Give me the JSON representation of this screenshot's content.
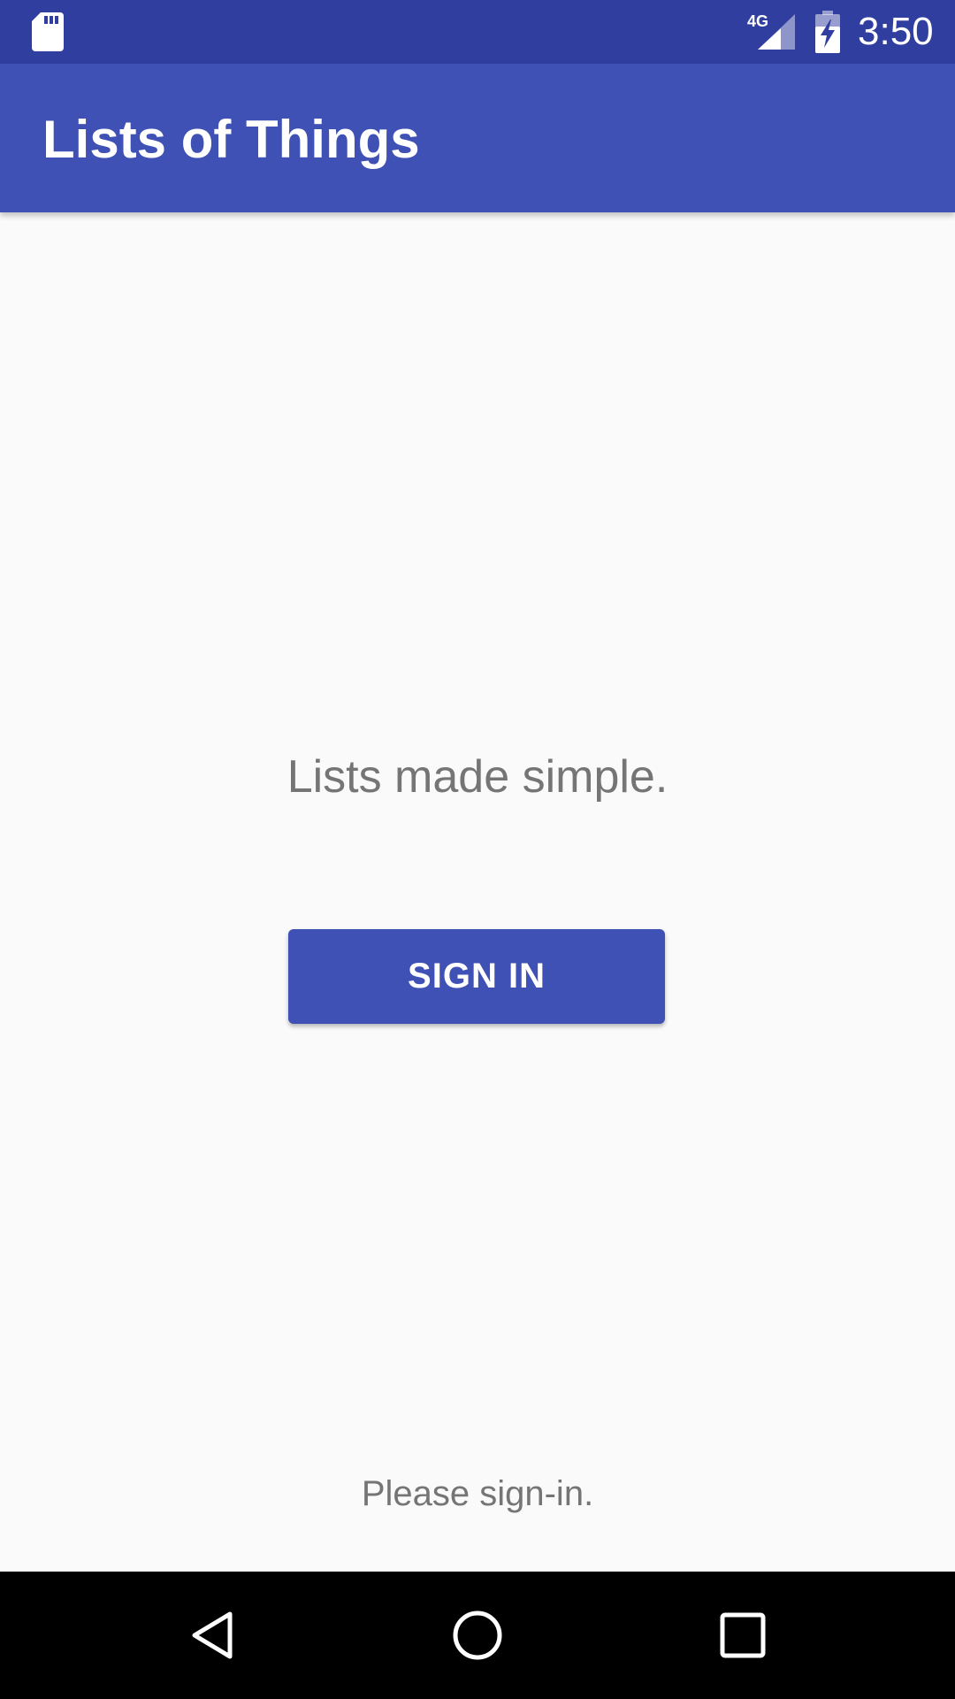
{
  "status_bar": {
    "network_label": "4G",
    "time": "3:50",
    "icons": [
      "sd-card-icon",
      "signal-4g-icon",
      "battery-charging-icon"
    ]
  },
  "app_bar": {
    "title": "Lists of Things"
  },
  "main": {
    "tagline": "Lists made simple.",
    "sign_in_label": "SIGN IN",
    "status_message": "Please sign-in."
  },
  "nav_bar": {
    "icons": [
      "back-icon",
      "home-icon",
      "recents-icon"
    ]
  },
  "colors": {
    "status_bar": "#303f9f",
    "primary": "#3f51b5",
    "background": "#fafafa",
    "secondary_text": "#757575",
    "nav_bar": "#000000"
  }
}
